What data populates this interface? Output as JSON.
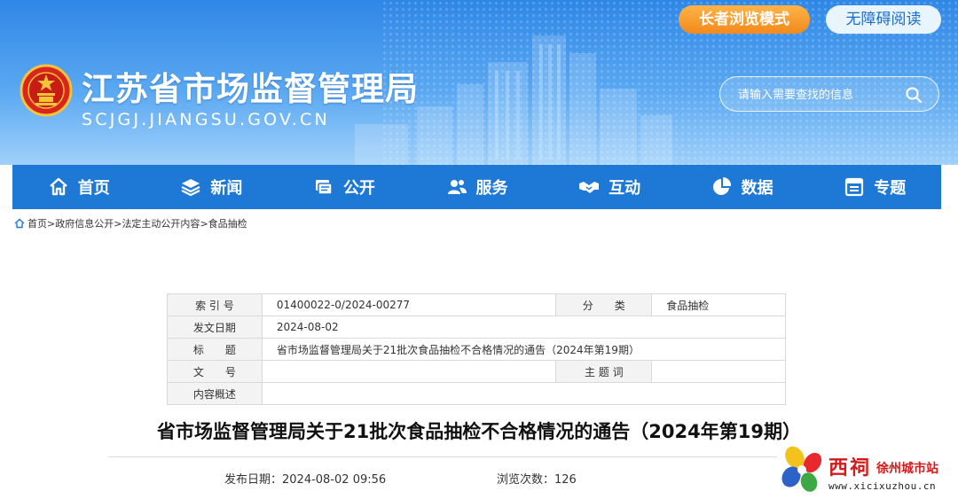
{
  "header": {
    "site_title": "江苏省市场监督管理局",
    "domain": "SCJGJ.JIANGSU.GOV.CN",
    "elder_mode_label": "长者浏览模式",
    "accessibility_label": "无障碍阅读",
    "search": {
      "placeholder": "请输入需要查找的信息",
      "value": ""
    }
  },
  "nav": {
    "items": [
      {
        "label": "首页",
        "icon": "home-icon"
      },
      {
        "label": "新闻",
        "icon": "layers-icon"
      },
      {
        "label": "公开",
        "icon": "document-stack-icon"
      },
      {
        "label": "服务",
        "icon": "users-icon"
      },
      {
        "label": "互动",
        "icon": "handshake-icon"
      },
      {
        "label": "数据",
        "icon": "pie-chart-icon"
      },
      {
        "label": "专题",
        "icon": "window-icon"
      }
    ]
  },
  "breadcrumb": {
    "items": [
      "首页",
      "政府信息公开",
      "法定主动公开内容",
      "食品抽检"
    ],
    "separator": ">"
  },
  "info": {
    "index_label": "索 引 号",
    "index_value": "01400022-0/2024-00277",
    "category_label": "分　　类",
    "category_value": "食品抽检",
    "date_label": "发文日期",
    "date_value": "2024-08-02",
    "title_label": "标　　题",
    "title_value": "省市场监督管理局关于21批次食品抽检不合格情况的通告（2024年第19期）",
    "docno_label": "文　　号",
    "docno_value": "",
    "keywords_label": "主 题 词",
    "keywords_value": "",
    "summary_label": "内容概述",
    "summary_value": ""
  },
  "article": {
    "title": "省市场监督管理局关于21批次食品抽检不合格情况的通告（2024年第19期）",
    "publish_date_label": "发布日期：",
    "publish_date": "2024-08-02 09:56",
    "views_label": "浏览次数：",
    "views": "126"
  },
  "watermark": {
    "brand": "西祠",
    "city": "徐州城市站",
    "domain": "www.xicixuzhou.cn"
  },
  "colors": {
    "header_blue": "#2f87e6",
    "nav_blue": "#1d78d6",
    "elder_orange": "#f28a1c",
    "watermark_red": "#d41a1a"
  }
}
